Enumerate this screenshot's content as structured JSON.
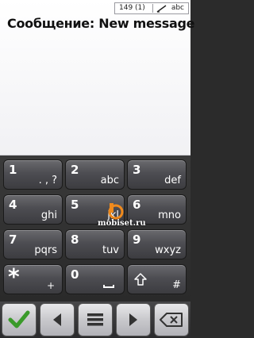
{
  "status": {
    "char_count": "149 (1)",
    "input_mode": "abc"
  },
  "message": {
    "title": "Сообщение: New message"
  },
  "keypad": {
    "keys": [
      {
        "digit": "1",
        "letters": ". , ?"
      },
      {
        "digit": "2",
        "letters": "abc"
      },
      {
        "digit": "3",
        "letters": "def"
      },
      {
        "digit": "4",
        "letters": "ghi"
      },
      {
        "digit": "5",
        "letters": "jkl"
      },
      {
        "digit": "6",
        "letters": "mno"
      },
      {
        "digit": "7",
        "letters": "pqrs"
      },
      {
        "digit": "8",
        "letters": "tuv"
      },
      {
        "digit": "9",
        "letters": "wxyz"
      },
      {
        "digit": "*",
        "letters": "+"
      },
      {
        "digit": "0",
        "letters": ""
      },
      {
        "digit": "",
        "letters": "#"
      }
    ]
  },
  "watermark": {
    "text": "mobiset.ru"
  },
  "toolbar": {
    "icons": [
      "checkmark-icon",
      "arrow-left-icon",
      "menu-icon",
      "arrow-right-icon",
      "backspace-icon"
    ]
  },
  "colors": {
    "accept_green": "#3a9a2a",
    "toolbar_icon": "#333333",
    "watermark_orange": "#f08a1c"
  }
}
